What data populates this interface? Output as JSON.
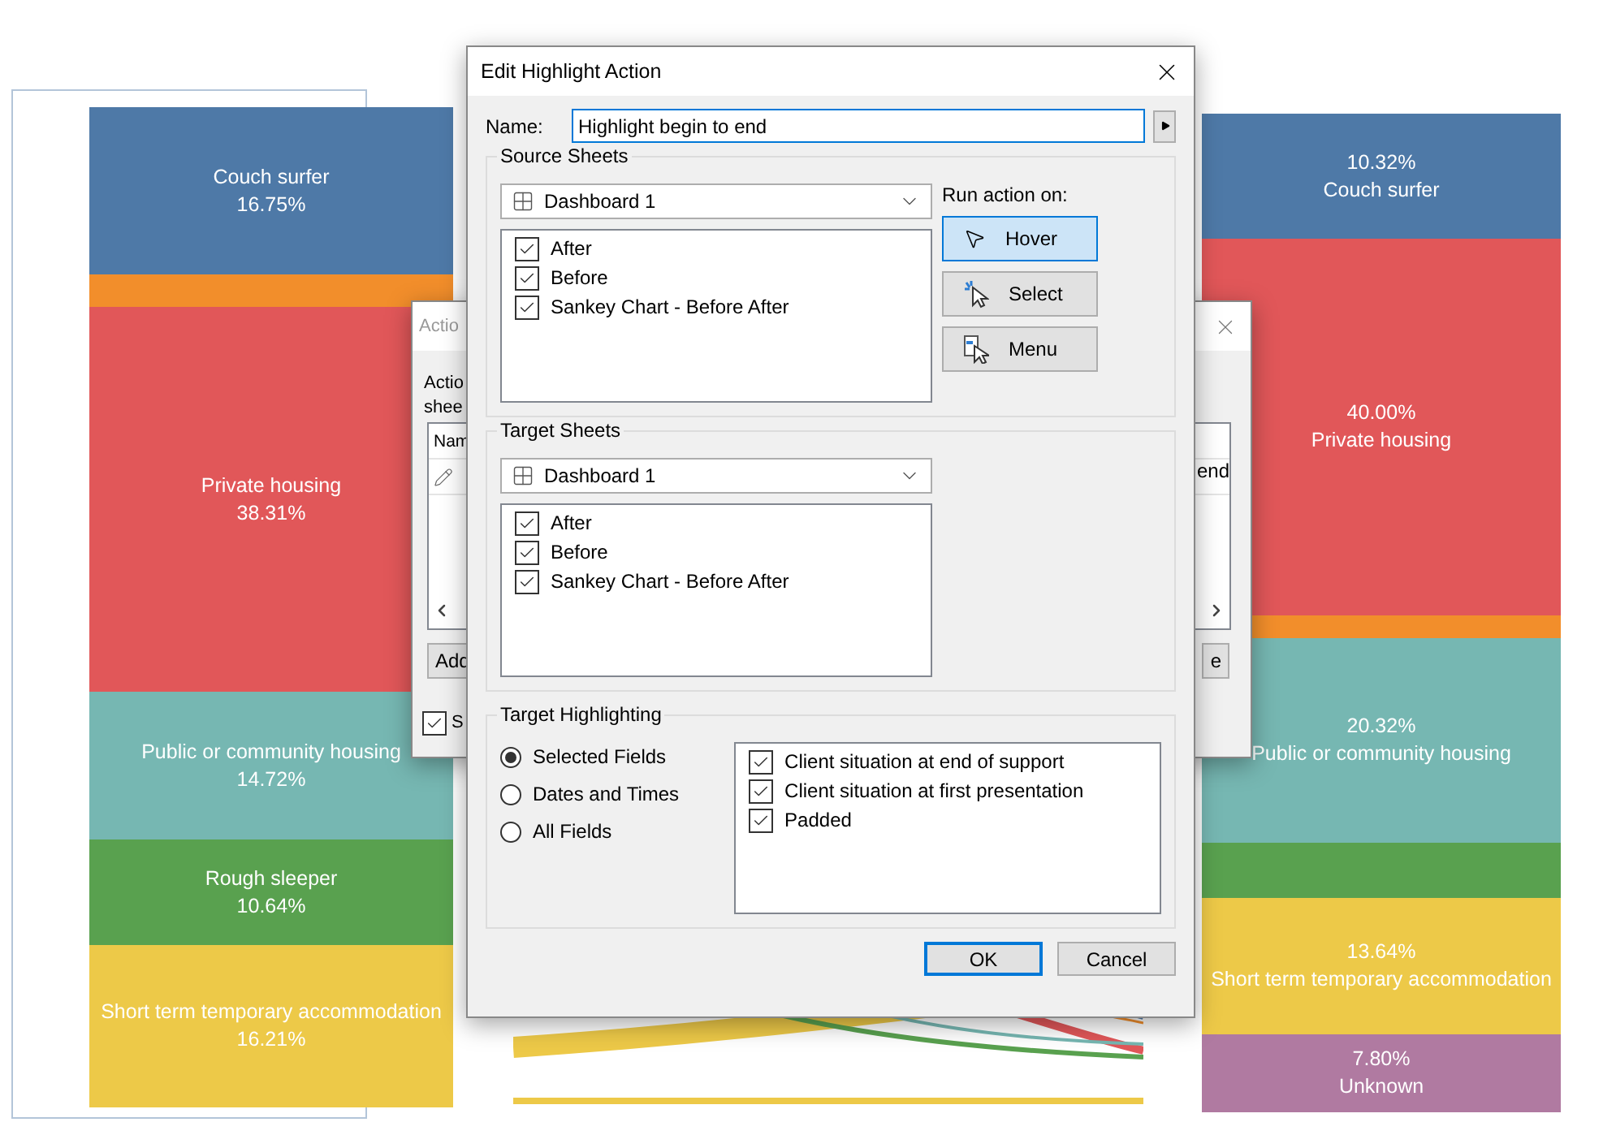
{
  "chart": {
    "left_bar": [
      {
        "label": "Couch surfer",
        "value": "16.75%",
        "color": "#4e79a7"
      },
      {
        "color": "#f28e2b"
      },
      {
        "label": "Private housing",
        "value": "38.31%",
        "color": "#e15759"
      },
      {
        "label": "Public or community housing",
        "value": "14.72%",
        "color": "#76b7b2"
      },
      {
        "label": "Rough sleeper",
        "value": "10.64%",
        "color": "#59a14f"
      },
      {
        "label": "Short term temporary accommodation",
        "value": "16.21%",
        "color": "#edc948"
      }
    ],
    "right_bar": [
      {
        "label": "Couch surfer",
        "value": "10.32%",
        "color": "#4e79a7"
      },
      {
        "label": "Private housing",
        "value": "40.00%",
        "color": "#e15759"
      },
      {
        "color": "#f28e2b"
      },
      {
        "label": "Public or community housing",
        "value": "20.32%",
        "color": "#76b7b2"
      },
      {
        "color": "#59a14f"
      },
      {
        "label": "Short term temporary accommodation",
        "value": "13.64%",
        "color": "#edc948"
      },
      {
        "label": "Unknown",
        "value": "7.80%",
        "color": "#b07aa1"
      }
    ]
  },
  "back_dialog": {
    "title": "Actio",
    "intro": [
      "Actio",
      "shee"
    ],
    "column_header": "Nam",
    "right_cell": "end",
    "left_button": "Add",
    "right_button": "e",
    "checkbox": {
      "label": "S",
      "checked": true
    }
  },
  "dialog": {
    "title": "Edit Highlight Action",
    "name_label": "Name:",
    "name_value": "Highlight begin to end",
    "source_sheets": {
      "title": "Source Sheets",
      "dropdown": "Dashboard 1",
      "sheets": [
        {
          "label": "After",
          "checked": true
        },
        {
          "label": "Before",
          "checked": true
        },
        {
          "label": "Sankey Chart - Before After",
          "checked": true
        }
      ]
    },
    "run_action": {
      "label": "Run action on:",
      "options": [
        {
          "label": "Hover",
          "kind": "hover",
          "selected": true
        },
        {
          "label": "Select",
          "kind": "select",
          "selected": false
        },
        {
          "label": "Menu",
          "kind": "menu",
          "selected": false
        }
      ]
    },
    "target_sheets": {
      "title": "Target Sheets",
      "dropdown": "Dashboard 1",
      "sheets": [
        {
          "label": "After",
          "checked": true
        },
        {
          "label": "Before",
          "checked": true
        },
        {
          "label": "Sankey Chart - Before After",
          "checked": true
        }
      ]
    },
    "target_highlighting": {
      "title": "Target Highlighting",
      "options": [
        {
          "label": "Selected Fields",
          "selected": true
        },
        {
          "label": "Dates and Times",
          "selected": false
        },
        {
          "label": "All Fields",
          "selected": false
        }
      ],
      "fields": [
        {
          "label": "Client situation at end of support",
          "checked": true
        },
        {
          "label": "Client situation at first presentation",
          "checked": true
        },
        {
          "label": "Padded",
          "checked": true
        }
      ]
    },
    "buttons": [
      {
        "label": "OK",
        "kind": "default"
      },
      {
        "label": "Cancel",
        "kind": "normal"
      }
    ]
  }
}
